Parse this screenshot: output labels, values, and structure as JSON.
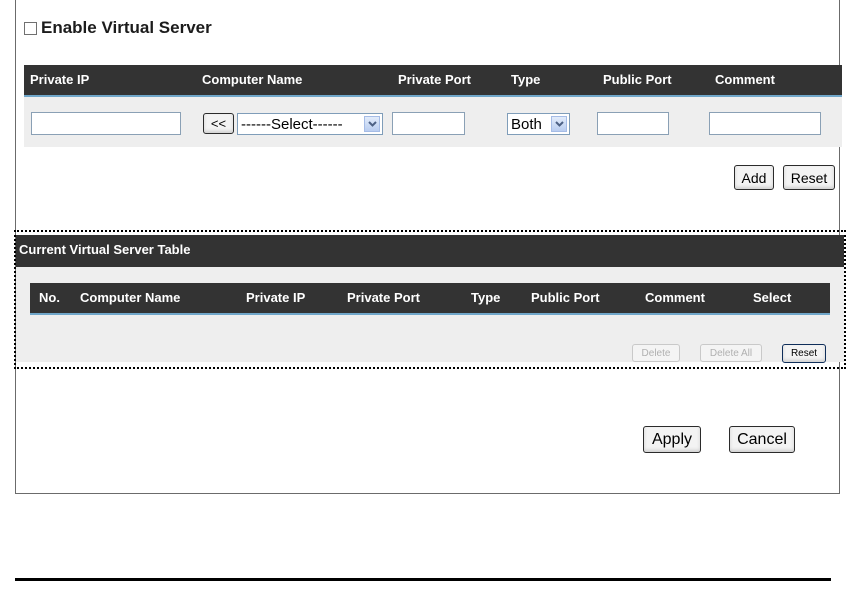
{
  "enable": {
    "label": "Enable Virtual Server",
    "checked": false
  },
  "form": {
    "columns": [
      "Private IP",
      "Computer Name",
      "Private Port",
      "Type",
      "Public Port",
      "Comment"
    ],
    "private_ip_value": "",
    "copy_button": "<<",
    "computer_select": "------Select------",
    "private_port_value": "",
    "type_select": "Both",
    "public_port_value": "",
    "comment_value": "",
    "add_button": "Add",
    "reset_button": "Reset"
  },
  "table": {
    "title": "Current Virtual Server Table",
    "columns": [
      "No.",
      "Computer Name",
      "Private IP",
      "Private Port",
      "Type",
      "Public Port",
      "Comment",
      "Select"
    ],
    "delete_button": "Delete",
    "delete_all_button": "Delete All",
    "reset_button": "Reset"
  },
  "footer": {
    "apply_button": "Apply",
    "cancel_button": "Cancel"
  }
}
